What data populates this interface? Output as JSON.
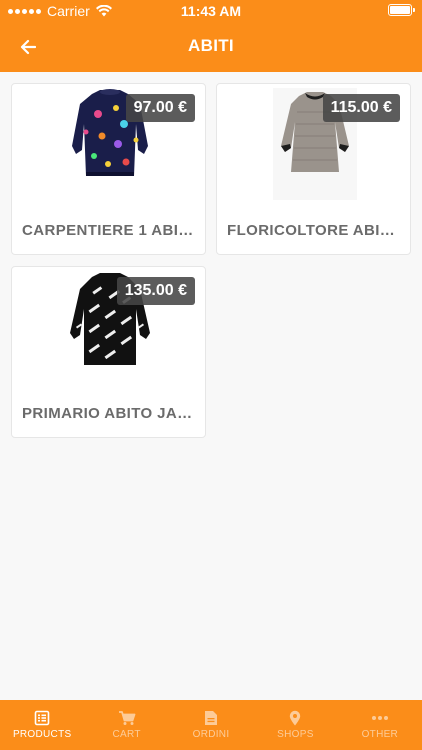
{
  "status_bar": {
    "carrier": "Carrier",
    "time": "11:43 AM"
  },
  "header": {
    "title": "ABITI",
    "back_icon": "arrow-left-icon"
  },
  "products": [
    {
      "name": "CARPENTIERE 1 ABIT...",
      "price": "97.00 €",
      "image": "colorful-sweater-dress"
    },
    {
      "name": "FLORICOLTORE ABIT...",
      "price": "115.00 €",
      "image": "grey-tweed-dress"
    },
    {
      "name": "PRIMARIO ABITO JAC...",
      "price": "135.00 €",
      "image": "black-logo-sweater-dress"
    }
  ],
  "tabs": [
    {
      "label": "PRODUCTS",
      "icon": "list-icon",
      "active": true
    },
    {
      "label": "CART",
      "icon": "cart-icon",
      "active": false
    },
    {
      "label": "ORDINI",
      "icon": "document-icon",
      "active": false
    },
    {
      "label": "SHOPS",
      "icon": "location-pin-icon",
      "active": false
    },
    {
      "label": "OTHER",
      "icon": "more-dots-icon",
      "active": false
    }
  ],
  "colors": {
    "accent": "#fb8d19",
    "badge": "#464646",
    "product_name": "#6b6b6b"
  }
}
